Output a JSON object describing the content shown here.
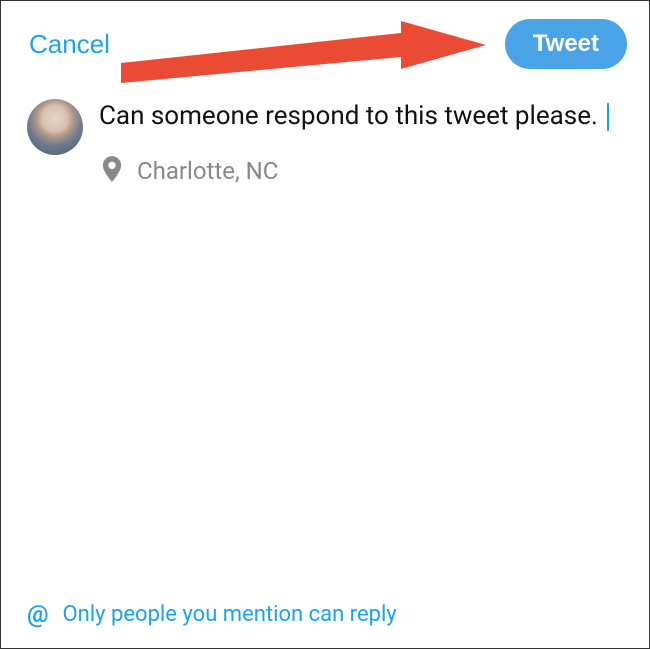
{
  "header": {
    "cancel_label": "Cancel",
    "tweet_label": "Tweet"
  },
  "compose": {
    "text": "Can someone respond to this tweet please. ",
    "location": "Charlotte, NC"
  },
  "footer": {
    "reply_restriction": "Only people you mention can reply"
  },
  "colors": {
    "accent": "#1da1f2",
    "arrow": "#e94b35"
  }
}
